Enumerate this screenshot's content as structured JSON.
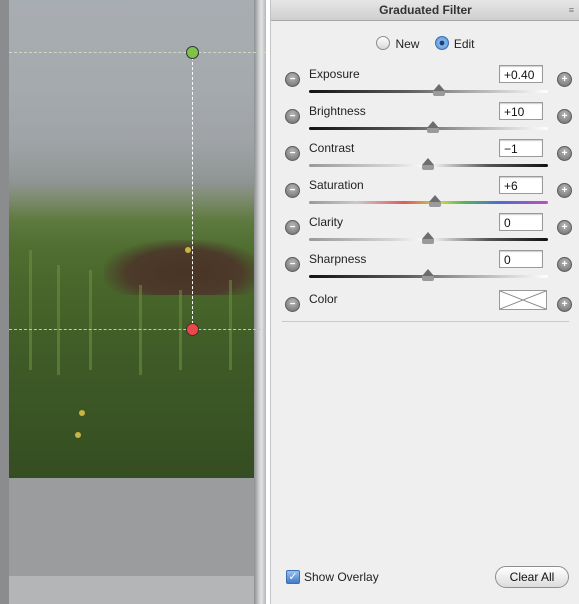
{
  "panel": {
    "title": "Graduated Filter",
    "menu_icon": "panel-menu-icon",
    "modes": [
      {
        "label": "New",
        "selected": false
      },
      {
        "label": "Edit",
        "selected": true
      }
    ]
  },
  "adjustments": [
    {
      "label": "Exposure",
      "value": "+0.40",
      "position": 0.55
    },
    {
      "label": "Brightness",
      "value": "+10",
      "position": 0.52
    },
    {
      "label": "Contrast",
      "value": "−1",
      "position": 0.5
    },
    {
      "label": "Saturation",
      "value": "+6",
      "position": 0.53
    },
    {
      "label": "Clarity",
      "value": "0",
      "position": 0.5
    },
    {
      "label": "Sharpness",
      "value": "0",
      "position": 0.5
    }
  ],
  "color": {
    "label": "Color"
  },
  "footer": {
    "show_overlay_label": "Show Overlay",
    "show_overlay_checked": true,
    "clear_all_label": "Clear All"
  },
  "colors": {
    "top_pin": "#7fc24a",
    "bottom_pin": "#e84848",
    "accent": "#3d6fb0"
  }
}
